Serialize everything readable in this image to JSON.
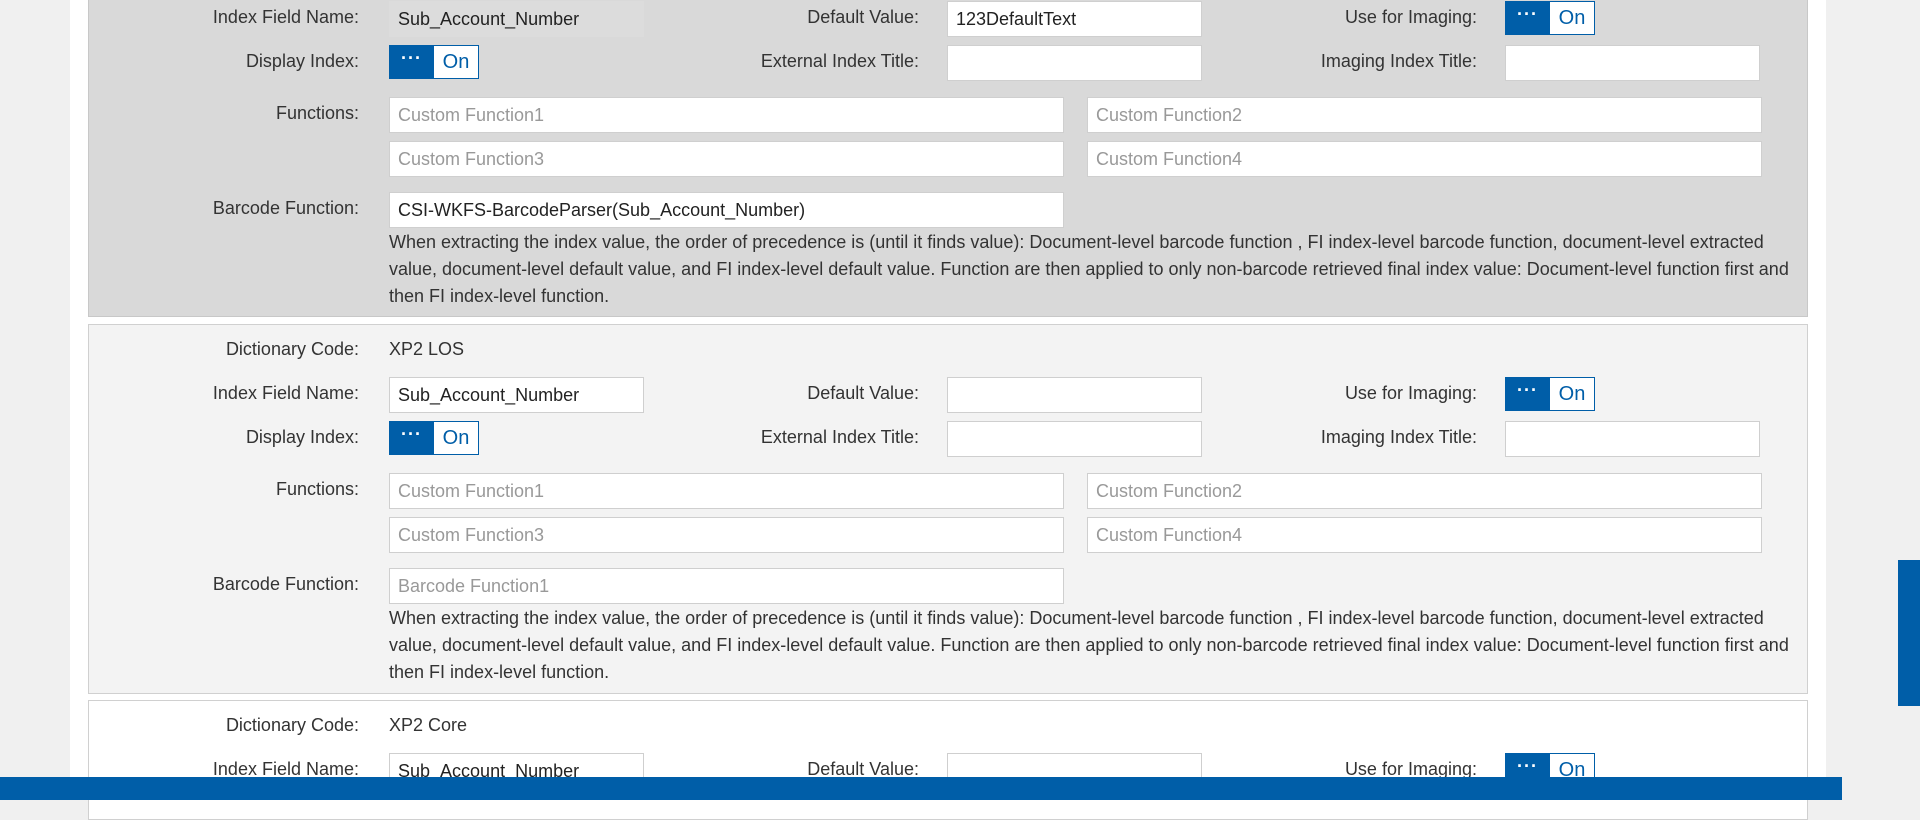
{
  "labels": {
    "dictionary_code": "Dictionary Code:",
    "index_field_name": "Index Field Name:",
    "default_value": "Default Value:",
    "use_for_imaging": "Use for Imaging:",
    "display_index": "Display Index:",
    "external_index_title": "External Index Title:",
    "imaging_index_title": "Imaging Index Title:",
    "functions": "Functions:",
    "barcode_function": "Barcode Function:"
  },
  "toggle": {
    "knob_glyph": "···",
    "on_label": "On"
  },
  "precedence_note": "When extracting the index value, the order of precedence is (until it finds value): Document-level barcode function , FI index-level barcode function, document-level extracted value, document-level default value, and FI index-level default value. Function are then applied to only non-barcode retrieved final index value: Document-level function first and then FI index-level function.",
  "entries": [
    {
      "index_field_name": "Sub_Account_Number",
      "default_value": "123DefaultText",
      "use_for_imaging": "On",
      "display_index": "On",
      "external_index_title": "",
      "imaging_index_title": "",
      "function_placeholders": [
        "Custom Function1",
        "Custom Function2",
        "Custom Function3",
        "Custom Function4"
      ],
      "barcode_function_value": "CSI-WKFS-BarcodeParser(Sub_Account_Number)"
    },
    {
      "dictionary_code": "XP2 LOS",
      "index_field_name": "Sub_Account_Number",
      "default_value": "",
      "use_for_imaging": "On",
      "display_index": "On",
      "external_index_title": "",
      "imaging_index_title": "",
      "function_placeholders": [
        "Custom Function1",
        "Custom Function2",
        "Custom Function3",
        "Custom Function4"
      ],
      "barcode_function_placeholder": "Barcode Function1"
    },
    {
      "dictionary_code": "XP2 Core",
      "index_field_name": "Sub_Account_Number",
      "default_value": "",
      "use_for_imaging": "On"
    }
  ],
  "colors": {
    "accent": "#005ea8",
    "selected_block_bg": "#d9d9d9",
    "alt_block_bg": "#f3f3f3",
    "page_bg": "#f0f0f0"
  }
}
